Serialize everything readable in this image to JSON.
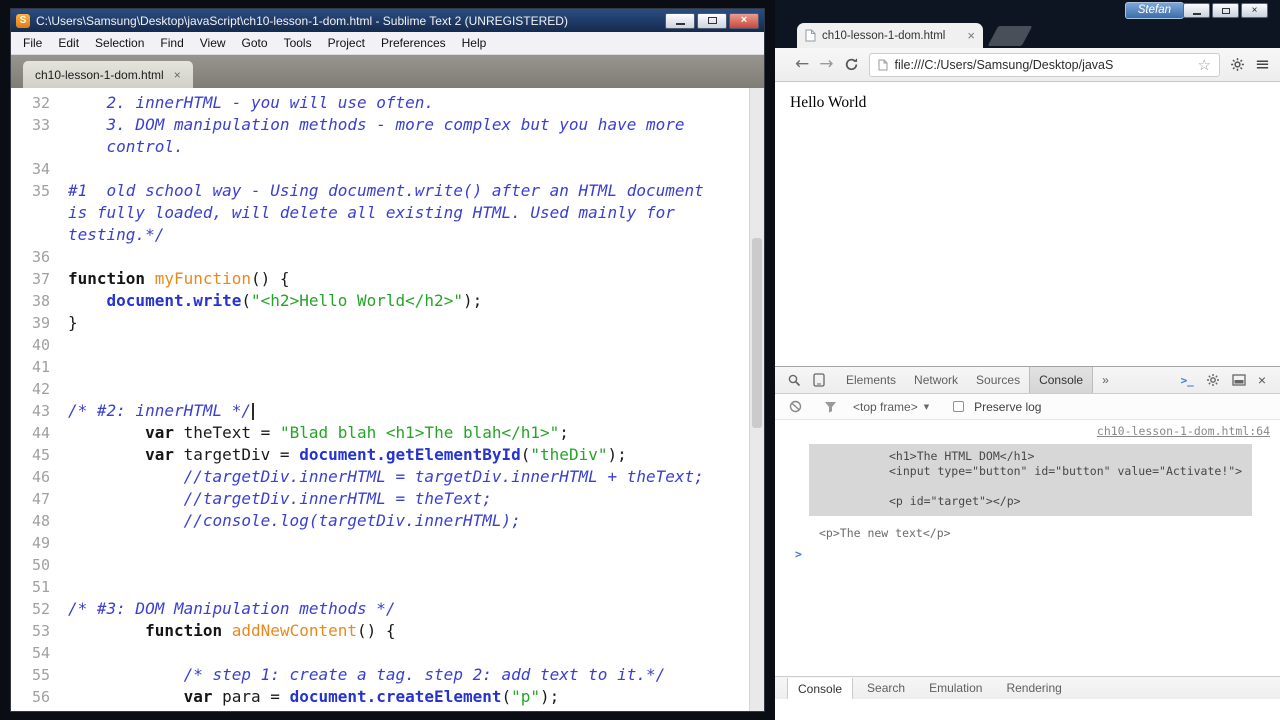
{
  "sublime": {
    "title": "C:\\Users\\Samsung\\Desktop\\javaScript\\ch10-lesson-1-dom.html - Sublime Text 2 (UNREGISTERED)",
    "menus": [
      "File",
      "Edit",
      "Selection",
      "Find",
      "View",
      "Goto",
      "Tools",
      "Project",
      "Preferences",
      "Help"
    ],
    "tab": {
      "label": "ch10-lesson-1-dom.html",
      "close": "×"
    },
    "editor": {
      "rows": [
        {
          "num": "32",
          "tokens": [
            [
              "c",
              "    2. innerHTML - you will use often."
            ]
          ]
        },
        {
          "num": "33",
          "tokens": [
            [
              "c",
              "    3. DOM manipulation methods - more complex but you have more"
            ]
          ]
        },
        {
          "num": "",
          "tokens": [
            [
              "c",
              "    control."
            ]
          ]
        },
        {
          "num": "34",
          "tokens": []
        },
        {
          "num": "35",
          "tokens": [
            [
              "c",
              "#1  old school way - Using document.write() after an HTML document"
            ]
          ]
        },
        {
          "num": "",
          "tokens": [
            [
              "c",
              "is fully loaded, will delete all existing HTML. Used mainly for"
            ]
          ]
        },
        {
          "num": "",
          "tokens": [
            [
              "c",
              "testing.*/"
            ]
          ]
        },
        {
          "num": "36",
          "tokens": []
        },
        {
          "num": "37",
          "tokens": [
            [
              "k",
              "function"
            ],
            [
              "p",
              " "
            ],
            [
              "f",
              "myFunction"
            ],
            [
              "p",
              "() {"
            ]
          ]
        },
        {
          "num": "38",
          "tokens": [
            [
              "p",
              "    "
            ],
            [
              "m",
              "document.write"
            ],
            [
              "p",
              "("
            ],
            [
              "s",
              "\"<h2>Hello World</h2>\""
            ],
            [
              "p",
              ");"
            ]
          ]
        },
        {
          "num": "39",
          "tokens": [
            [
              "p",
              "}"
            ]
          ]
        },
        {
          "num": "40",
          "tokens": []
        },
        {
          "num": "41",
          "tokens": []
        },
        {
          "num": "42",
          "tokens": []
        },
        {
          "num": "43",
          "tokens": [
            [
              "c",
              "/* #2: innerHTML */"
            ]
          ],
          "caret": true
        },
        {
          "num": "44",
          "tokens": [
            [
              "p",
              "        "
            ],
            [
              "k",
              "var"
            ],
            [
              "p",
              " theText = "
            ],
            [
              "s",
              "\"Blad blah <h1>The blah</h1>\""
            ],
            [
              "p",
              ";"
            ]
          ]
        },
        {
          "num": "45",
          "tokens": [
            [
              "p",
              "        "
            ],
            [
              "k",
              "var"
            ],
            [
              "p",
              " targetDiv = "
            ],
            [
              "m",
              "document.getElementById"
            ],
            [
              "p",
              "("
            ],
            [
              "s",
              "\"theDiv\""
            ],
            [
              "p",
              ");"
            ]
          ]
        },
        {
          "num": "46",
          "tokens": [
            [
              "c",
              "            //targetDiv.innerHTML = targetDiv.innerHTML + theText;"
            ]
          ]
        },
        {
          "num": "47",
          "tokens": [
            [
              "c",
              "            //targetDiv.innerHTML = theText;"
            ]
          ]
        },
        {
          "num": "48",
          "tokens": [
            [
              "c",
              "            //console.log(targetDiv.innerHTML);"
            ]
          ]
        },
        {
          "num": "49",
          "tokens": []
        },
        {
          "num": "50",
          "tokens": []
        },
        {
          "num": "51",
          "tokens": []
        },
        {
          "num": "52",
          "tokens": [
            [
              "c",
              "/* #3: DOM Manipulation methods */"
            ]
          ]
        },
        {
          "num": "53",
          "tokens": [
            [
              "p",
              "        "
            ],
            [
              "k",
              "function"
            ],
            [
              "p",
              " "
            ],
            [
              "f",
              "addNewContent"
            ],
            [
              "p",
              "() {"
            ]
          ]
        },
        {
          "num": "54",
          "tokens": []
        },
        {
          "num": "55",
          "tokens": [
            [
              "c",
              "            /* step 1: create a tag. step 2: add text to it.*/"
            ]
          ]
        },
        {
          "num": "56",
          "tokens": [
            [
              "p",
              "            "
            ],
            [
              "k",
              "var"
            ],
            [
              "p",
              " para = "
            ],
            [
              "m",
              "document.createElement"
            ],
            [
              "p",
              "("
            ],
            [
              "s",
              "\"p\""
            ],
            [
              "p",
              ");"
            ]
          ]
        }
      ]
    }
  },
  "chrome": {
    "presenter_badge": "Stefan",
    "tab": {
      "label": "ch10-lesson-1-dom.html",
      "close": "×"
    },
    "address": "file:///C:/Users/Samsung/Desktop/javaS",
    "page_text": "Hello World",
    "devtools": {
      "tabs": [
        "Elements",
        "Network",
        "Sources",
        "Console",
        "»"
      ],
      "selected_tab": "Console",
      "frame_selector": "<top frame>",
      "preserve_log_label": "Preserve log",
      "log_link": "ch10-lesson-1-dom.html:64",
      "log_block_lines": [
        "<h1>The HTML DOM</h1>",
        "<input type=\"button\" id=\"button\" value=\"Activate!\">",
        "",
        "<p id=\"target\"></p>"
      ],
      "log_tail_line": "<p>The new text</p>",
      "prompt": ">",
      "drawer_tabs": [
        "Console",
        "Search",
        "Emulation",
        "Rendering"
      ],
      "drawer_selected": "Console"
    }
  },
  "icons": {
    "sublime_logo": "S",
    "back": "←",
    "forward": "→",
    "bookmark": "☆",
    "menu": "≡",
    "chevron_down": "▼",
    "close": "×",
    "console_drawer": ">_"
  }
}
